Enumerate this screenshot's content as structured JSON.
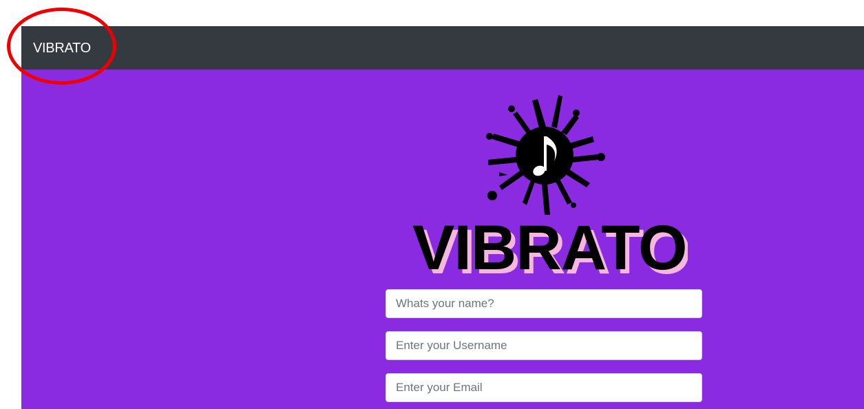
{
  "navbar": {
    "brand": "VIBRATO",
    "background": "#343a40"
  },
  "main": {
    "background": "#8a2be2"
  },
  "logo": {
    "icon": "music-note-splash-icon",
    "wordmark": "VIBRATO"
  },
  "form": {
    "name_placeholder": "Whats your name?",
    "username_placeholder": "Enter your Username",
    "email_placeholder": "Enter your Email"
  },
  "annotation": {
    "type": "red-circle-highlight",
    "color": "#ee0000"
  }
}
